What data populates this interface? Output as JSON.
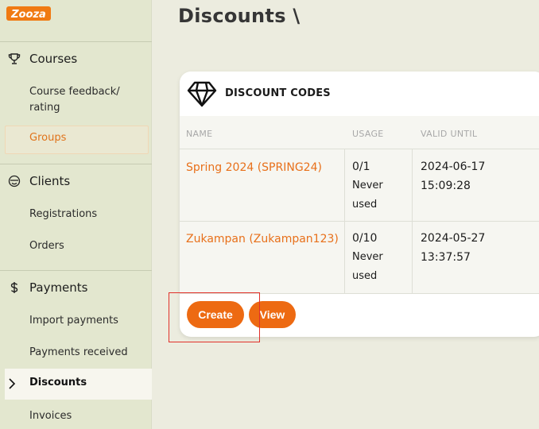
{
  "brand": {
    "logo_text": "Zooza",
    "accent": "#ed6a12"
  },
  "sidebar": {
    "courses": {
      "label": "Courses",
      "icon": "trophy-icon",
      "items": [
        "Course feedback/ rating",
        "Groups"
      ]
    },
    "clients": {
      "label": "Clients",
      "icon": "smile-icon",
      "items": [
        "Registrations",
        "Orders"
      ]
    },
    "payments": {
      "label": "Payments",
      "icon": "dollar-icon",
      "items": [
        "Import payments",
        "Payments received",
        "Discounts",
        "Invoices"
      ]
    },
    "active_item": "Discounts"
  },
  "page": {
    "title": "Discounts \\"
  },
  "card": {
    "title": "DISCOUNT CODES",
    "icon": "diamond-icon",
    "columns": [
      "NAME",
      "USAGE",
      "VALID UNTIL"
    ],
    "rows": [
      {
        "name": "Spring 2024 (SPRING24)",
        "usage": "0/1",
        "usage_note": "Never used",
        "valid_date": "2024-06-17",
        "valid_time": "15:09:28"
      },
      {
        "name": "Zukampan (Zukampan123)",
        "usage": "0/10",
        "usage_note": "Never used",
        "valid_date": "2024-05-27",
        "valid_time": "13:37:57"
      }
    ],
    "buttons": {
      "create": "Create",
      "view": "View"
    }
  }
}
